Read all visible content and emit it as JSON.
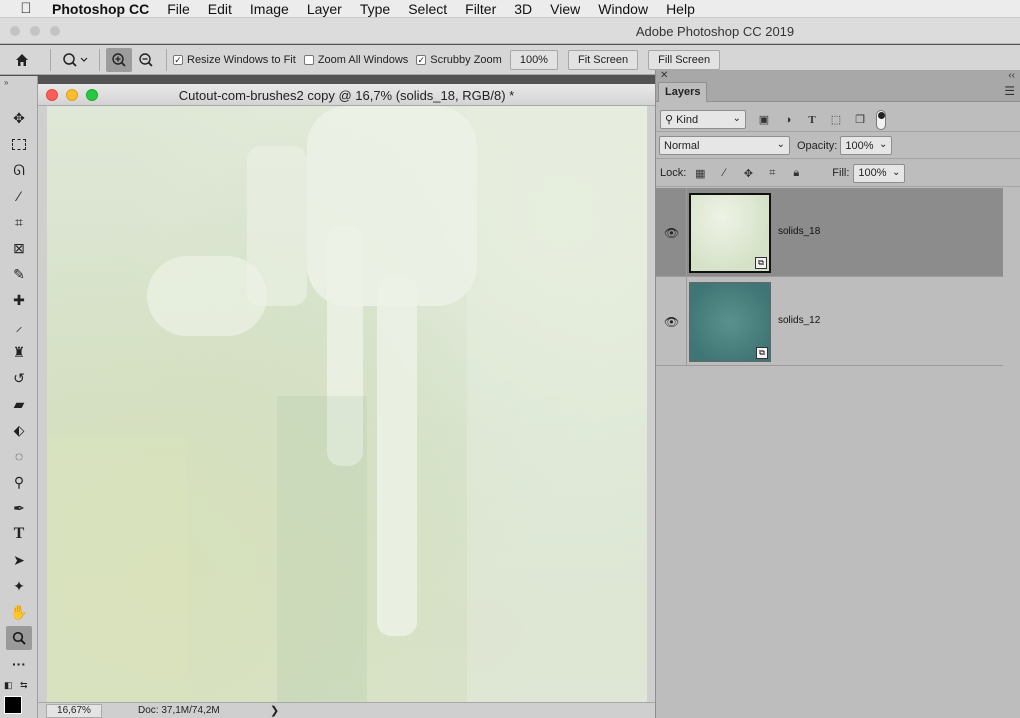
{
  "menubar": {
    "apple": "",
    "app_name": "Photoshop CC",
    "items": [
      "File",
      "Edit",
      "Image",
      "Layer",
      "Type",
      "Select",
      "Filter",
      "3D",
      "View",
      "Window",
      "Help"
    ]
  },
  "window": {
    "title": "Adobe Photoshop CC 2019"
  },
  "options": {
    "home_icon": "home-icon",
    "resize_windows": {
      "label": "Resize Windows to Fit",
      "checked": true
    },
    "zoom_all": {
      "label": "Zoom All Windows",
      "checked": false
    },
    "scrubby_zoom": {
      "label": "Scrubby Zoom",
      "checked": true
    },
    "zoom_value": "100%",
    "fit_screen": "Fit Screen",
    "fill_screen": "Fill Screen"
  },
  "document": {
    "title": "Cutout-com-brushes2 copy @ 16,7% (solids_18, RGB/8) *",
    "zoom": "16,67%",
    "doc_info": "Doc: 37,1M/74,2M",
    "arrow": "❯"
  },
  "layers_panel": {
    "tab": "Layers",
    "filter_kind": "Kind",
    "blend_mode": "Normal",
    "opacity_label": "Opacity:",
    "opacity_value": "100%",
    "lock_label": "Lock:",
    "fill_label": "Fill:",
    "fill_value": "100%",
    "layers": [
      {
        "name": "solids_18",
        "selected": true,
        "thumb_color": "#dfe8d3"
      },
      {
        "name": "solids_12",
        "selected": false,
        "thumb_color": "#4f8584"
      }
    ]
  },
  "colors": {
    "menubar": "#ececec",
    "canvas": "#d8e2cc",
    "selected_layer": "#8c8c8c"
  }
}
